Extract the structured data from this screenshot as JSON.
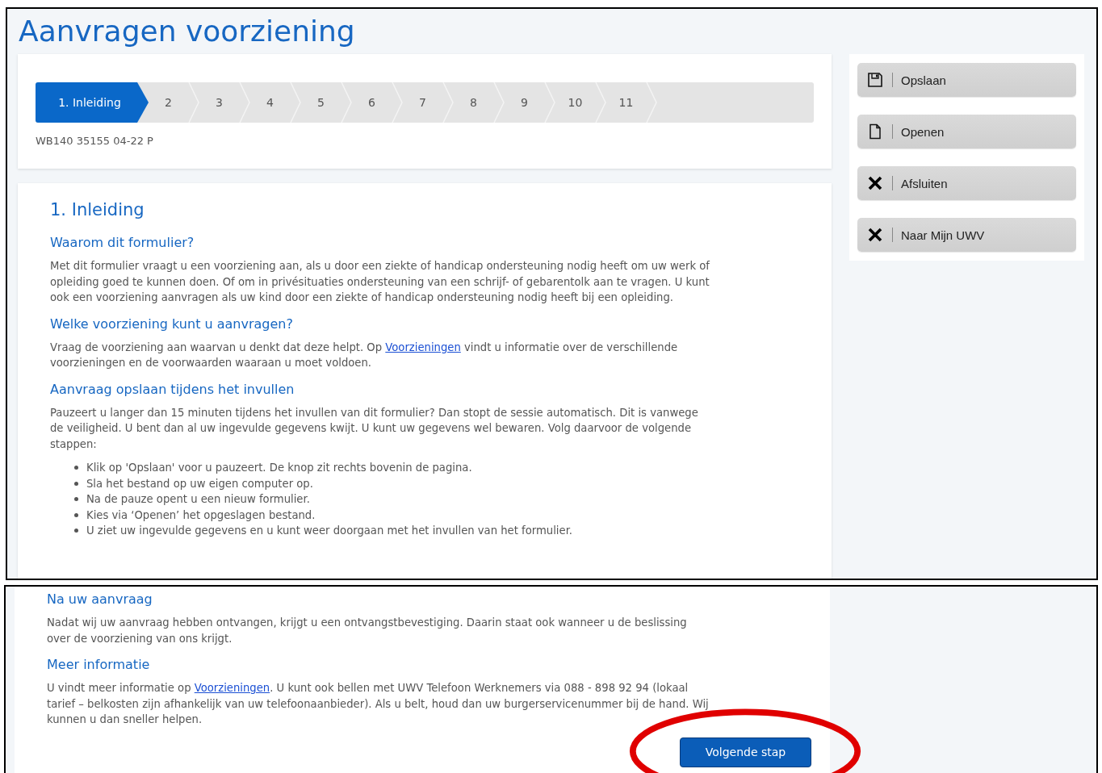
{
  "page_title": "Aanvragen voorziening",
  "steps": [
    {
      "label": "1. Inleiding",
      "selected": true
    },
    {
      "label": "2",
      "selected": false
    },
    {
      "label": "3",
      "selected": false
    },
    {
      "label": "4",
      "selected": false
    },
    {
      "label": "5",
      "selected": false
    },
    {
      "label": "6",
      "selected": false
    },
    {
      "label": "7",
      "selected": false
    },
    {
      "label": "8",
      "selected": false
    },
    {
      "label": "9",
      "selected": false
    },
    {
      "label": "10",
      "selected": false
    },
    {
      "label": "11",
      "selected": false
    }
  ],
  "form_code": "WB140 35155 04-22 P",
  "section_title": "1. Inleiding",
  "blocks_top": [
    {
      "heading": "Waarom dit formulier?",
      "paragraph": [
        {
          "text": "Met dit formulier vraagt u een voorziening aan, als u door een ziekte of handicap ondersteuning nodig heeft om uw werk of opleiding goed te kunnen doen. Of om in privésituaties ondersteuning van een schrijf- of gebarentolk aan te vragen. U kunt ook een voorziening aanvragen als uw kind door een ziekte of handicap ondersteuning nodig heeft bij een opleiding."
        }
      ]
    },
    {
      "heading": "Welke voorziening kunt u aanvragen?",
      "paragraph": [
        {
          "text": "Vraag de voorziening aan waarvan u denkt dat deze helpt. Op "
        },
        {
          "link": "Voorzieningen"
        },
        {
          "text": " vindt u informatie over de verschillende voorzieningen en de voorwaarden waaraan u moet voldoen."
        }
      ]
    },
    {
      "heading": "Aanvraag opslaan tijdens het invullen",
      "paragraph": [
        {
          "text": "Pauzeert u langer dan 15 minuten tijdens het invullen van dit formulier? Dan stopt de sessie automatisch. Dit is vanwege de veiligheid. U bent dan al uw ingevulde gegevens kwijt. U kunt uw gegevens wel bewaren. Volg daarvoor de volgende stappen:"
        }
      ],
      "bullets": [
        "Klik op 'Opslaan' voor u pauzeert. De knop zit rechts bovenin de pagina.",
        "Sla het bestand op uw eigen computer op.",
        "Na de pauze opent u een nieuw formulier.",
        "Kies via ‘Openen’ het opgeslagen bestand.",
        "U ziet uw ingevulde gegevens en u kunt weer doorgaan met het invullen van het formulier."
      ]
    }
  ],
  "blocks_bottom": [
    {
      "heading": "Na uw aanvraag",
      "paragraph": [
        {
          "text": "Nadat wij uw aanvraag hebben ontvangen, krijgt u een ontvangstbevestiging. Daarin staat ook wanneer u de beslissing over de voorziening van ons krijgt."
        }
      ]
    },
    {
      "heading": "Meer informatie",
      "paragraph": [
        {
          "text": "U vindt meer informatie op "
        },
        {
          "link": "Voorzieningen"
        },
        {
          "text": ". U kunt ook bellen met UWV Telefoon Werknemers via 088 - 898 92 94 (lokaal tarief – belkosten zijn afhankelijk van uw telefoonaanbieder). Als u belt, houd dan uw burgerservicenummer bij de hand. Wij kunnen u dan sneller helpen."
        }
      ]
    }
  ],
  "next_button": "Volgende stap",
  "side_buttons": [
    {
      "kind": "save",
      "label": "Opslaan"
    },
    {
      "kind": "open",
      "label": "Openen"
    },
    {
      "kind": "close",
      "label": "Afsluiten"
    },
    {
      "kind": "close",
      "label": "Naar Mijn UWV"
    }
  ]
}
